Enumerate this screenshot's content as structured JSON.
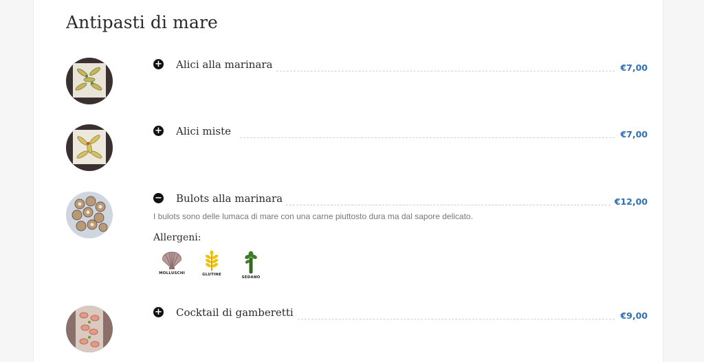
{
  "section": {
    "title": "Antipasti di mare"
  },
  "items": [
    {
      "name": "Alici alla marinara",
      "price": "€7,00",
      "expanded": false,
      "toggle": "+"
    },
    {
      "name": "Alici miste",
      "price": "€7,00",
      "expanded": false,
      "toggle": "+"
    },
    {
      "name": "Bulots alla marinara",
      "price": "€12,00",
      "expanded": true,
      "toggle": "−",
      "description": "I bulots sono delle lumaca di mare con una carne piuttosto dura ma dal sapore delicato.",
      "allergens_label": "Allergeni:",
      "allergens": [
        {
          "label": "MOLLUSCHI",
          "icon": "shell-icon"
        },
        {
          "label": "GLUTINE",
          "icon": "wheat-icon"
        },
        {
          "label": "SEDANO",
          "icon": "celery-icon"
        }
      ]
    },
    {
      "name": "Cocktail di gamberetti",
      "price": "€9,00",
      "expanded": false,
      "toggle": "+"
    }
  ],
  "colors": {
    "price": "#2f6fb0",
    "text": "#2b2b2b",
    "description": "#777777"
  }
}
